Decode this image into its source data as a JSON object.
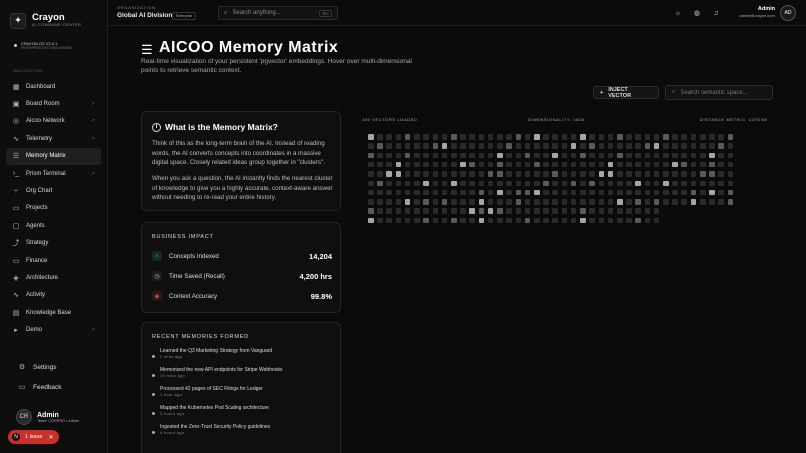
{
  "brand": {
    "name": "Crayon",
    "sub": "AI Command Center",
    "logo_letter": "✦"
  },
  "system": {
    "version": "CRAYON OS V2.4.1",
    "status": "ENTERPRISE SYSTEMS NOMINAL"
  },
  "nav": {
    "label": "NAVIGATION",
    "items": [
      {
        "label": "Dashboard",
        "icon": "grid-icon",
        "glyph": "▦",
        "ext": false,
        "active": false
      },
      {
        "label": "Board Room",
        "icon": "briefcase-icon",
        "glyph": "▣",
        "ext": true,
        "active": false
      },
      {
        "label": "Aicoo Network",
        "icon": "globe-icon",
        "glyph": "◎",
        "ext": true,
        "active": false
      },
      {
        "label": "Telemetry",
        "icon": "activity-icon",
        "glyph": "∿",
        "ext": true,
        "active": false
      },
      {
        "label": "Memory Matrix",
        "icon": "database-icon",
        "glyph": "☰",
        "ext": false,
        "active": true
      },
      {
        "label": "Prism Terminal",
        "icon": "terminal-icon",
        "glyph": "›_",
        "ext": true,
        "active": false
      },
      {
        "label": "Org Chart",
        "icon": "org-chart-icon",
        "glyph": "⑂",
        "ext": false,
        "active": false
      },
      {
        "label": "Projects",
        "icon": "folder-icon",
        "glyph": "▭",
        "ext": false,
        "active": false
      },
      {
        "label": "Agents",
        "icon": "chat-icon",
        "glyph": "▢",
        "ext": false,
        "active": false
      },
      {
        "label": "Strategy",
        "icon": "trend-icon",
        "glyph": "⤴",
        "ext": false,
        "active": false
      },
      {
        "label": "Finance",
        "icon": "card-icon",
        "glyph": "▭",
        "ext": false,
        "active": false
      },
      {
        "label": "Architecture",
        "icon": "layers-icon",
        "glyph": "◈",
        "ext": false,
        "active": false
      },
      {
        "label": "Activity",
        "icon": "pulse-icon",
        "glyph": "∿",
        "ext": false,
        "active": false
      },
      {
        "label": "Knowledge Base",
        "icon": "book-icon",
        "glyph": "▤",
        "ext": false,
        "active": false
      },
      {
        "label": "Demo",
        "icon": "play-icon",
        "glyph": "▸",
        "ext": true,
        "active": false
      }
    ]
  },
  "sidebar_bottom": {
    "settings": "Settings",
    "feedback": "Feedback"
  },
  "user": {
    "initials": "CR",
    "name": "Admin",
    "team": "Team: CORPRO",
    "role": "• Admin"
  },
  "issue": {
    "count": "N",
    "label": "1 issue"
  },
  "topbar": {
    "org_label": "ORGANIZATION",
    "org_name": "Global AI Division",
    "org_badge": "Enterprise",
    "search_placeholder": "Search anything...",
    "search_kbd": "⌘K",
    "admin_name": "Admin",
    "admin_email": "admin@crayon.com",
    "admin_initials": "AD"
  },
  "hero": {
    "title": "AICOO Memory Matrix",
    "description": "Real-time visualization of your persistent 'pgvector' embeddings. Hover over multi-dimensional points to retrieve semantic context.",
    "inject_label": "INJECT VECTOR",
    "semantic_placeholder": "Search semantic space..."
  },
  "what_is": {
    "title": "What is the Memory Matrix?",
    "p1": "Think of this as the long-term brain of the AI. Instead of reading words, the AI converts concepts into coordinates in a massive digital space. Closely related ideas group together in \"clusters\".",
    "p2": "When you ask a question, the AI instantly finds the nearest cluster of knowledge to give you a highly accurate, context-aware answer without needing to re-read your entire history."
  },
  "impact": {
    "label": "BUSINESS IMPACT",
    "metrics": [
      {
        "label": "Concepts Indexed",
        "value": "14,204",
        "icon": "network-icon",
        "glyph": "⋔",
        "color": "#2f7a4f",
        "bg": "#15291d"
      },
      {
        "label": "Time Saved (Recall)",
        "value": "4,200 hrs",
        "icon": "clock-icon",
        "glyph": "◷",
        "color": "#bbbbbb",
        "bg": "#1c1c1c"
      },
      {
        "label": "Context Accuracy",
        "value": "99.8%",
        "icon": "target-icon",
        "glyph": "◉",
        "color": "#d24a4a",
        "bg": "#2a1616"
      }
    ]
  },
  "recent": {
    "label": "RECENT MEMORIES FORMED",
    "items": [
      {
        "text": "Learned the Q3 Marketing Strategy from Vanguard",
        "time": "2 mins ago"
      },
      {
        "text": "Memorized the new API endpoints for Stripe Webhooks",
        "time": "15 mins ago"
      },
      {
        "text": "Processed 42 pages of SEC Filings for Ledger",
        "time": "1 hour ago"
      },
      {
        "text": "Mapped the Kubernetes Pod Scaling architecture",
        "time": "3 hours ago"
      },
      {
        "text": "Ingested the Zero-Trust Security Policy guidelines",
        "time": "4 hours ago"
      }
    ]
  },
  "matrix": {
    "vectors_loaded": "400 VECTORS LOADED",
    "dimensionality": "DIMENSIONALITY: 1536",
    "distance_metric": "DISTANCE METRIC: COSINE",
    "cols": 40,
    "rows": 10,
    "colors": {
      "dim": "#2a2a2a",
      "mid": "#5a5a5a",
      "bright": "#a6a6a6"
    }
  }
}
